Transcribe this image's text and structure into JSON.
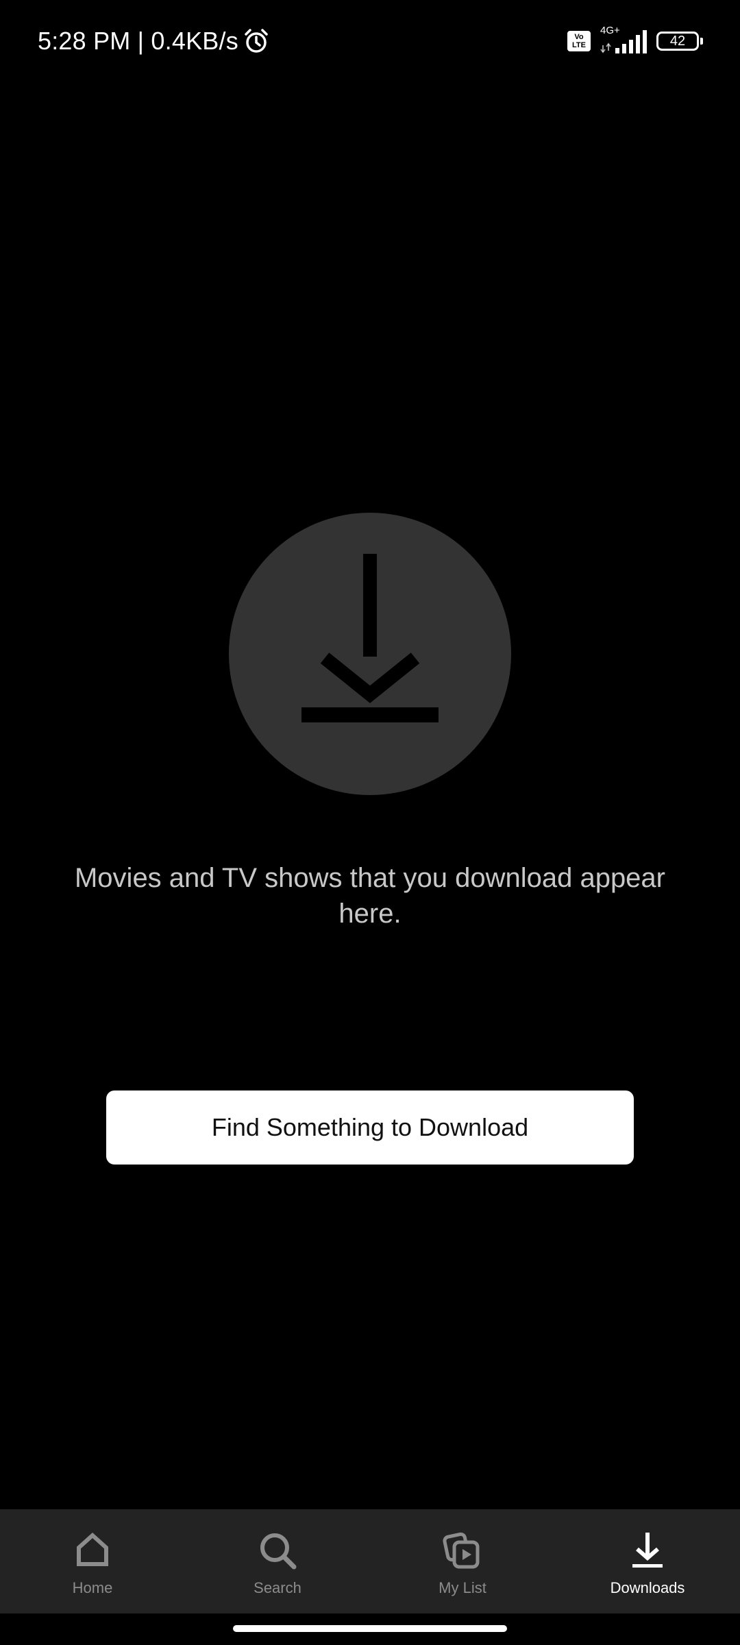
{
  "status_bar": {
    "time_speed": "5:28 PM | 0.4KB/s",
    "volte_top": "Vo",
    "volte_bottom": "LTE",
    "network": "4G+",
    "battery": "42"
  },
  "main": {
    "icon": "download-icon",
    "message": "Movies and TV shows that you download appear here.",
    "button_label": "Find Something to Download"
  },
  "bottom_nav": {
    "items": [
      {
        "label": "Home",
        "icon": "home-icon",
        "active": false
      },
      {
        "label": "Search",
        "icon": "search-icon",
        "active": false
      },
      {
        "label": "My List",
        "icon": "my-list-icon",
        "active": false
      },
      {
        "label": "Downloads",
        "icon": "download-icon",
        "active": true
      }
    ]
  },
  "colors": {
    "background": "#000000",
    "circle": "#333333",
    "nav_background": "#232323",
    "inactive": "#8c8c8c",
    "active": "#ffffff"
  }
}
